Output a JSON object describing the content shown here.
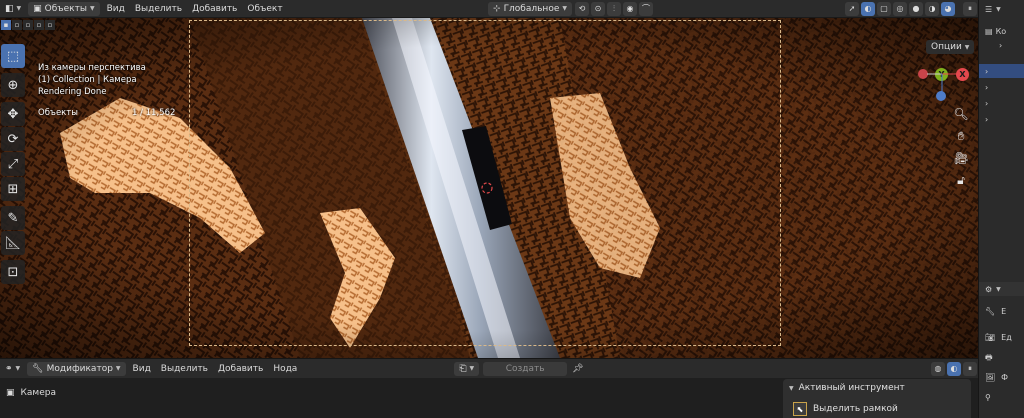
{
  "header": {
    "mode_label": "Объекты",
    "menu": [
      "Вид",
      "Выделить",
      "Добавить",
      "Объект"
    ],
    "transform_orientation": "Глобальное"
  },
  "overlay": {
    "line1": "Из камеры перспектива",
    "line2": "(1) Collection | Камера",
    "line3": "Rendering Done",
    "objects_label": "Объекты",
    "objects_value": "1 / 11,562"
  },
  "viewport": {
    "options_label": "Опции",
    "gizmo": {
      "x_label": "X",
      "y_label": "Y",
      "x_color": "#e5484d",
      "y_color": "#7fb01c",
      "z_color": "#4e7cc9"
    }
  },
  "toolbar": {
    "tools": [
      "select-box-icon",
      "cursor-icon",
      "move-icon",
      "rotate-icon",
      "scale-icon",
      "transform-icon",
      "annotate-icon",
      "measure-icon",
      "add-cube-icon"
    ]
  },
  "right_panel": {
    "labels": [
      "Ко",
      "Е",
      "Ед",
      "Ф"
    ]
  },
  "bottom": {
    "editor_label": "Модификатор",
    "menu": [
      "Вид",
      "Выделить",
      "Добавить",
      "Нода"
    ],
    "create_label": "Создать",
    "object_name": "Камера"
  },
  "active_tool": {
    "title": "Активный инструмент",
    "tool_name": "Выделить рамкой"
  },
  "colors": {
    "accent": "#4a72b0",
    "header_bg": "#2b2b2b",
    "scene_dark": "#3a1f0e",
    "scene_light": "#f2b078",
    "camera_frame": "#d9b98a"
  }
}
